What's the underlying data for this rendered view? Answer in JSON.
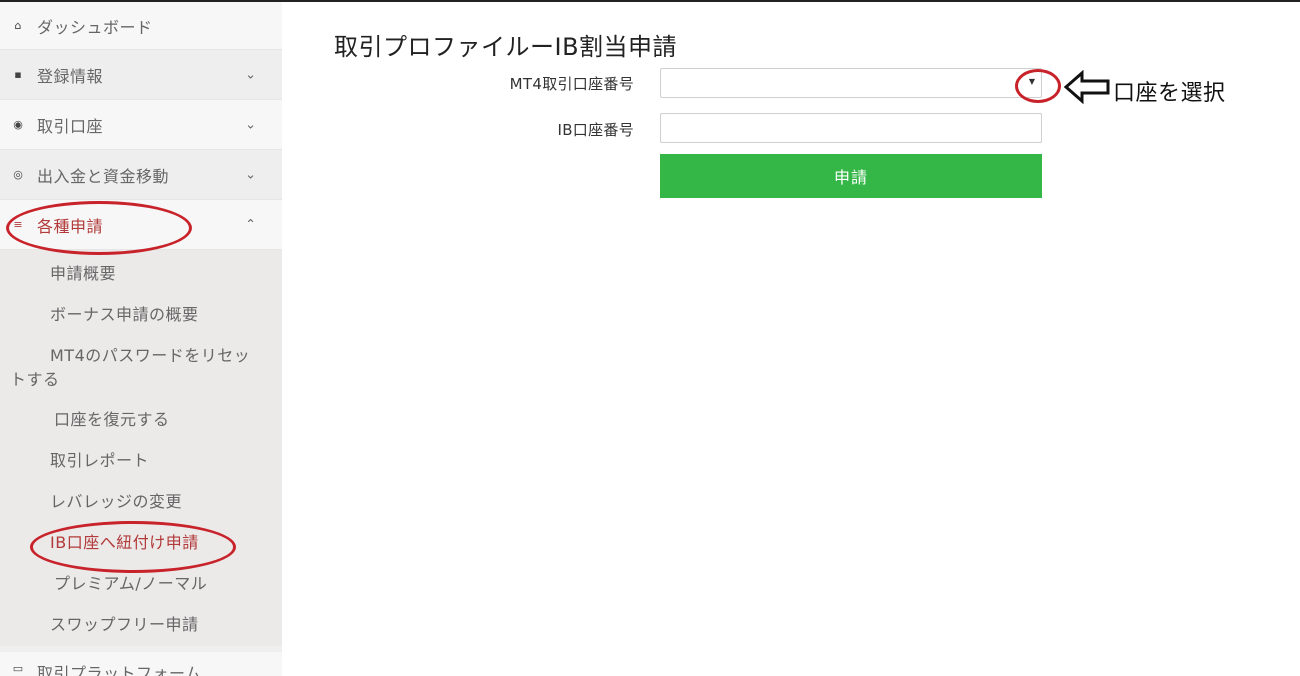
{
  "sidebar": {
    "items": [
      {
        "icon": "home-icon",
        "glyph": "⌂",
        "label": "ダッシュボード",
        "chevron": ""
      },
      {
        "icon": "id-card-icon",
        "glyph": "▪",
        "label": "登録情報",
        "chevron": "⌄"
      },
      {
        "icon": "eye-icon",
        "glyph": "◉",
        "label": "取引口座",
        "chevron": "⌄"
      },
      {
        "icon": "coin-icon",
        "glyph": "◎",
        "label": "出入金と資金移動",
        "chevron": "⌄"
      },
      {
        "icon": "list-icon",
        "glyph": "≡",
        "label": "各種申請",
        "chevron": "⌃"
      }
    ],
    "submenu": [
      "申請概要",
      "ボーナス申請の概要",
      {
        "line1": "MT4のパスワードをリセッ",
        "line2": "トする"
      },
      "口座を復元する",
      "取引レポート",
      "レバレッジの変更",
      "IB口座へ紐付け申請",
      "プレミアム/ノーマル",
      "スワップフリー申請"
    ],
    "bottom_item": {
      "icon": "platform-icon",
      "glyph": "▭",
      "label": "取引プラットフォーム"
    }
  },
  "main": {
    "title": "取引プロファイルーIB割当申請",
    "fields": {
      "mt4_account_label": "MT4取引口座番号",
      "mt4_account_value": "",
      "ib_account_label": "IB口座番号",
      "ib_account_value": ""
    },
    "submit_label": "申請"
  },
  "annotation": {
    "callout_text": "口座を選択"
  },
  "colors": {
    "accent_red": "#c8232b",
    "submit_green": "#35b748",
    "active_text": "#b23a3a"
  }
}
